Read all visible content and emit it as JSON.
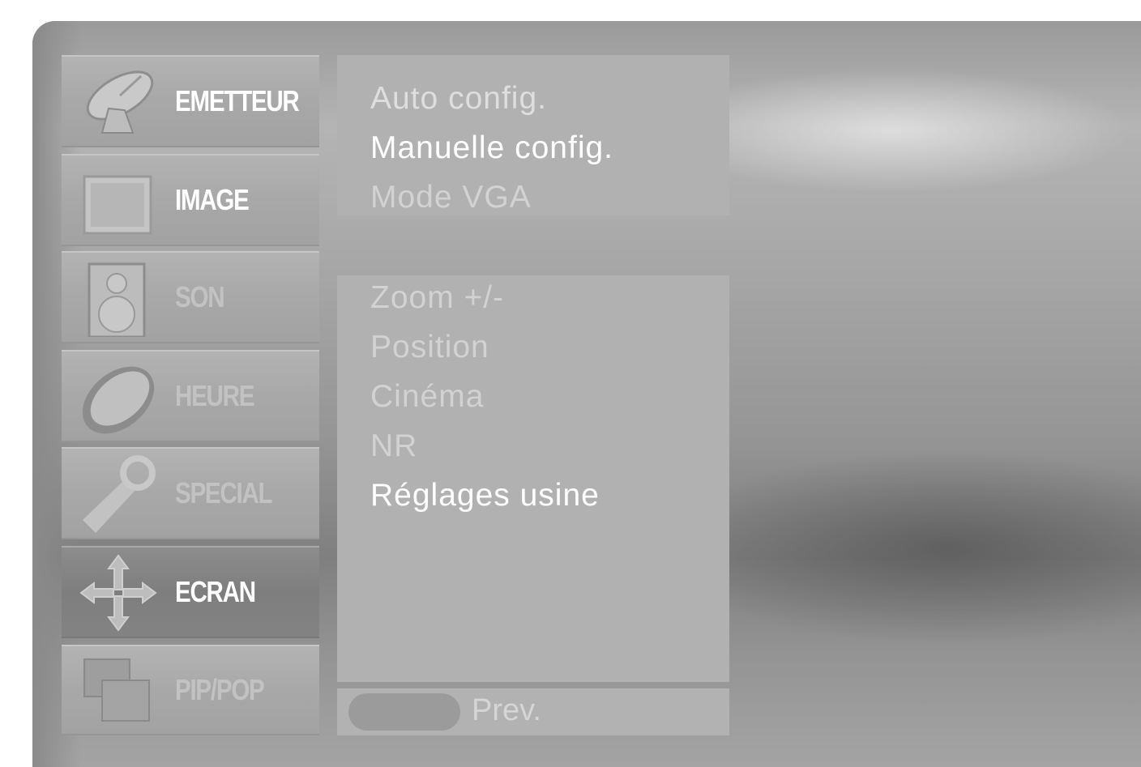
{
  "main_menu": {
    "items": [
      {
        "label": "EMETTEUR",
        "icon": "satellite-dish-icon",
        "state": "normal"
      },
      {
        "label": "IMAGE",
        "icon": "monitor-icon",
        "state": "normal"
      },
      {
        "label": "SON",
        "icon": "speaker-icon",
        "state": "dim"
      },
      {
        "label": "HEURE",
        "icon": "clock-icon",
        "state": "dim"
      },
      {
        "label": "SPECIAL",
        "icon": "wrench-icon",
        "state": "dim"
      },
      {
        "label": "ECRAN",
        "icon": "move-arrows-icon",
        "state": "selected"
      },
      {
        "label": "PIP/POP",
        "icon": "pip-windows-icon",
        "state": "dim"
      }
    ]
  },
  "submenu_top": {
    "items": [
      "Auto config.",
      "Manuelle config.",
      "Mode VGA"
    ]
  },
  "submenu_bottom": {
    "items": [
      "Zoom +/-",
      "Position",
      "Cinéma",
      "NR",
      "Réglages usine"
    ]
  },
  "footer": {
    "prev_label": "Prev."
  },
  "colors": {
    "tile": "#a8a8a8",
    "tile_selected": "#828282",
    "panel": "#b1b1b1",
    "text_bright": "#ffffff",
    "text_dim": "#d2d2d2"
  }
}
